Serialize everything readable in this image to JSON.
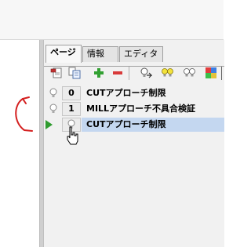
{
  "tabs": [
    {
      "label": "ページ",
      "active": true
    },
    {
      "label": "情報",
      "active": false
    },
    {
      "label": "エディタ",
      "active": false
    }
  ],
  "toolbar": {
    "icons": [
      "page-new-icon",
      "page-copy-icon",
      "add-icon",
      "remove-icon",
      "bulb-arrow-icon",
      "bulb-yellow-icon",
      "bulb-gray-icon",
      "palette-icon"
    ]
  },
  "pages": [
    {
      "number": "0",
      "title": "CUTアプローチ制限",
      "current": false,
      "selected": false
    },
    {
      "number": "1",
      "title": "MILLアプローチ不具合検証",
      "current": false,
      "selected": false
    },
    {
      "number": "",
      "title": "CUTアプローチ制限",
      "current": true,
      "selected": true
    }
  ],
  "colors": {
    "selection": "#c4d7f0",
    "annotation_red": "#d42020",
    "play_green": "#2e9b2e"
  }
}
